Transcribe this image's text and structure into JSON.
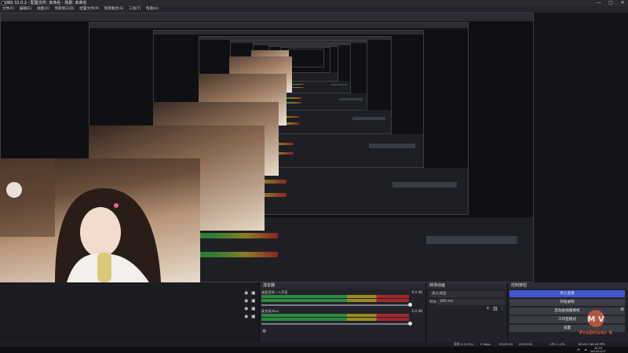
{
  "titlebar": {
    "title": "OBS 32.0.2 - 配置文件: 未命名 - 场景: 未命名",
    "minimize": "—",
    "maximize": "▢",
    "close": "✕"
  },
  "menu": [
    "文件(F)",
    "编辑(E)",
    "视图(V)",
    "停靠窗口(D)",
    "配置文件(P)",
    "场景集合(S)",
    "工具(T)",
    "帮助(H)"
  ],
  "audio_mixer": {
    "title": "混音器",
    "channels": [
      {
        "name": "桌面音频 / 人声音",
        "db": "0.0 dB"
      },
      {
        "name": "麦克风/Aux",
        "db": "0.0 dB"
      }
    ]
  },
  "transitions": {
    "title": "转场动画",
    "type": "淡入淡出",
    "duration_label": "时长",
    "duration_value": "300 ms"
  },
  "controls": {
    "title": "控制按钮",
    "buttons": [
      "停止直播",
      "开始录制",
      "启动虚拟摄像机",
      "工作室模式",
      "设置"
    ]
  },
  "status": {
    "dropped": "丢帧 0 (0.0%)",
    "bitrate": "0 kbps",
    "stream_time": "00:00:00",
    "rec_time": "00:00:00",
    "cpu": "CPU: 1.2%",
    "fps": "60.00 / 60.00 FPS"
  },
  "taskbar": {
    "time": "14:10",
    "date": "2025/11/17"
  },
  "logo": {
    "brand": "ProDriver 4",
    "letters": "M V"
  },
  "colors": {
    "accent": "#3f56cf",
    "meter_green": "#2b8a3e",
    "meter_yellow": "#9c8a23",
    "meter_red": "#a3262c",
    "logo_text": "#e04b2a"
  }
}
